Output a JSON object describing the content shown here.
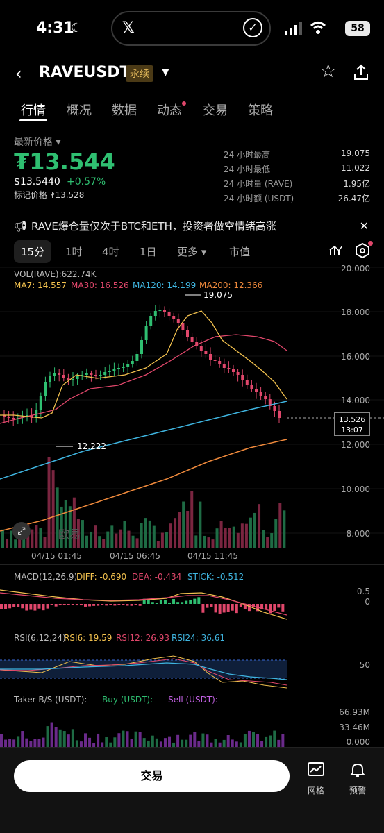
{
  "status": {
    "time": "4:31",
    "battery": "58"
  },
  "header": {
    "symbol": "RAVEUSDT",
    "perp_label": "永续"
  },
  "tabs": [
    "行情",
    "概况",
    "数据",
    "动态",
    "交易",
    "策略"
  ],
  "price": {
    "label": "最新价格",
    "last": "₮13.544",
    "usd": "$13.5440",
    "change": "+0.57%",
    "mark": "标记价格 ₮13.528"
  },
  "stats": [
    {
      "label": "24 小时最高",
      "value": "19.075"
    },
    {
      "label": "24 小时最低",
      "value": "11.022"
    },
    {
      "label": "24 小时量 (RAVE)",
      "value": "1.95亿"
    },
    {
      "label": "24 小时额 (USDT)",
      "value": "26.47亿"
    }
  ],
  "news": {
    "text": "RAVE爆仓量仅次于BTC和ETH，投资者做空情绪高涨"
  },
  "intervals": [
    "15分",
    "1时",
    "4时",
    "1日",
    "更多",
    "市值"
  ],
  "main_chart": {
    "vol": "VOL(RAVE):622.74K",
    "ma7": "MA7: 14.557",
    "ma30": "MA30: 16.526",
    "ma120": "MA120: 14.199",
    "ma200": "MA200: 12.366",
    "y_ticks": [
      "20.000",
      "18.000",
      "16.000",
      "14.000",
      "12.000",
      "10.000",
      "8.000"
    ],
    "high_label": "19.075",
    "low_label": "12.222",
    "current_price": "13.526",
    "countdown": "13:07",
    "x_ticks": [
      "04/15 01:45",
      "04/15 06:45",
      "04/15 11:45"
    ],
    "watermark": "欧易"
  },
  "macd": {
    "title": "MACD(12,26,9)",
    "diff": "DIFF: -0.690",
    "dea": "DEA: -0.434",
    "stick": "STICK: -0.512",
    "ticks": [
      "0.5",
      "0"
    ]
  },
  "rsi": {
    "title": "RSI(6,12,24)",
    "rsi6": "RSI6: 19.59",
    "rsi12": "RSI12: 26.93",
    "rsi24": "RSI24: 36.61",
    "ticks": [
      "50"
    ]
  },
  "taker": {
    "title": "Taker B/S (USDT): --",
    "buy": "Buy (USDT): --",
    "sell": "Sell (USDT): --",
    "ticks": [
      "66.93M",
      "33.46M",
      "0.000"
    ]
  },
  "bottom": {
    "trade": "交易",
    "grid": "网格",
    "alert": "预警"
  },
  "colors": {
    "up": "#2fbf71",
    "down": "#e0476b",
    "ma7": "#f2c14e",
    "ma30": "#e0476b",
    "ma120": "#3fb5e0",
    "ma200": "#f08a3c"
  }
}
